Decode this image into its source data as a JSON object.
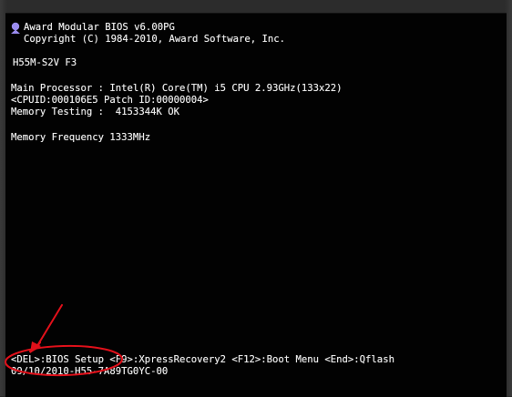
{
  "bios": {
    "header_line1": "Award Modular BIOS v6.00PG",
    "header_line2": "Copyright (C) 1984-2010, Award Software, Inc.",
    "board_model": "H55M-S2V F3",
    "processor_line": "Main Processor : Intel(R) Core(TM) i5 CPU 2.93GHz(133x22)",
    "cpuid_line": "<CPUID:000106E5 Patch ID:00000004>",
    "memory_test_line": "Memory Testing :  4153344K OK",
    "memory_freq_line": "Memory Frequency 1333MHz",
    "hotkeys_line": "<DEL>:BIOS Setup <F9>:XpressRecovery2 <F12>:Boot Menu <End>:Qflash",
    "bios_id_line": "09/10/2010-H55-7A89TG0YC-00"
  },
  "colors": {
    "screen_bg": "#020202",
    "text": "#eaeaea",
    "award_icon": "#9b8cf0",
    "annotation": "#e0101a"
  },
  "icons": {
    "award_logo": "award-logo-icon"
  },
  "annotation": {
    "type": "red arrow and ellipse highlighting the DEL BIOS Setup hotkey"
  }
}
